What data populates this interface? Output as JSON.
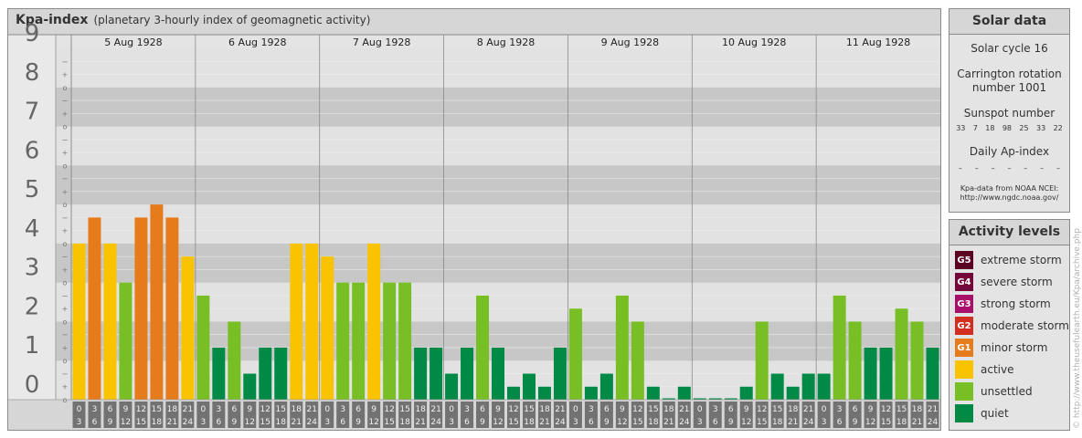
{
  "title": {
    "main": "Kpa-index",
    "sub": "(planetary 3-hourly index of geomagnetic activity)"
  },
  "chart_data": {
    "type": "bar",
    "title": "Kpa-index",
    "subtitle": "(planetary 3-hourly index of geomagnetic activity)",
    "ylim": [
      0,
      9
    ],
    "y_major_ticks": [
      "0",
      "1",
      "2",
      "3",
      "4",
      "5",
      "6",
      "7",
      "8",
      "9"
    ],
    "y_minor_ticks": [
      "o",
      "+",
      "−"
    ],
    "days": [
      "5 Aug 1928",
      "6 Aug 1928",
      "7 Aug 1928",
      "8 Aug 1928",
      "9 Aug 1928",
      "10 Aug 1928",
      "11 Aug 1928"
    ],
    "interval_start_labels": [
      "0",
      "3",
      "6",
      "9",
      "12",
      "15",
      "18",
      "21"
    ],
    "interval_end_labels": [
      "3",
      "6",
      "9",
      "12",
      "15",
      "18",
      "21",
      "24"
    ],
    "values": [
      [
        4.0,
        4.667,
        4.0,
        3.0,
        4.667,
        5.0,
        4.667,
        3.667
      ],
      [
        2.667,
        1.333,
        2.0,
        0.667,
        1.333,
        1.333,
        4.0,
        4.0
      ],
      [
        3.667,
        3.0,
        3.0,
        4.0,
        3.0,
        3.0,
        1.333,
        1.333
      ],
      [
        0.667,
        1.333,
        2.667,
        1.333,
        0.333,
        0.667,
        0.333,
        1.333
      ],
      [
        2.333,
        0.333,
        0.667,
        2.667,
        2.0,
        0.333,
        0.0,
        0.333
      ],
      [
        0.0,
        0.0,
        0.0,
        0.333,
        2.0,
        0.667,
        0.333,
        0.667
      ],
      [
        0.667,
        2.667,
        2.0,
        1.333,
        1.333,
        2.333,
        2.0,
        1.333
      ]
    ],
    "grid": true
  },
  "colors": {
    "G5": "#5b0022",
    "G4": "#73073b",
    "G3": "#a80f6a",
    "G2": "#d12e1f",
    "G1": "#e57b1b",
    "active": "#f9c300",
    "unsettled": "#78bf25",
    "quiet": "#008a45",
    "band_dark": "#c7c7c7",
    "band_light": "#e2e2e2",
    "tick_box": "#727272"
  },
  "solar": {
    "heading": "Solar data",
    "cycle": "Solar cycle 16",
    "carrington_line1": "Carrington rotation",
    "carrington_line2": "number 1001",
    "sunspot_heading": "Sunspot number",
    "sunspots": [
      "33",
      "7",
      "18",
      "98",
      "25",
      "33",
      "22"
    ],
    "ap_heading": "Daily Ap-index",
    "ap": [
      "–",
      "–",
      "–",
      "–",
      "–",
      "–",
      "–"
    ],
    "source_line1": "Kpa-data from NOAA NCEI:",
    "source_line2": "http://www.ngdc.noaa.gov/"
  },
  "activity": {
    "heading": "Activity levels",
    "items": [
      {
        "badge": "G5",
        "label": "extreme storm",
        "color": "#5b0022"
      },
      {
        "badge": "G4",
        "label": "severe storm",
        "color": "#73073b"
      },
      {
        "badge": "G3",
        "label": "strong storm",
        "color": "#a80f6a"
      },
      {
        "badge": "G2",
        "label": "moderate storm",
        "color": "#d12e1f"
      },
      {
        "badge": "G1",
        "label": "minor storm",
        "color": "#e57b1b"
      },
      {
        "badge": "",
        "label": "active",
        "color": "#f9c300"
      },
      {
        "badge": "",
        "label": "unsettled",
        "color": "#78bf25"
      },
      {
        "badge": "",
        "label": "quiet",
        "color": "#008a45"
      }
    ]
  },
  "credit": "© http://www.theusefulearth.eu/Kpa/archive.php"
}
